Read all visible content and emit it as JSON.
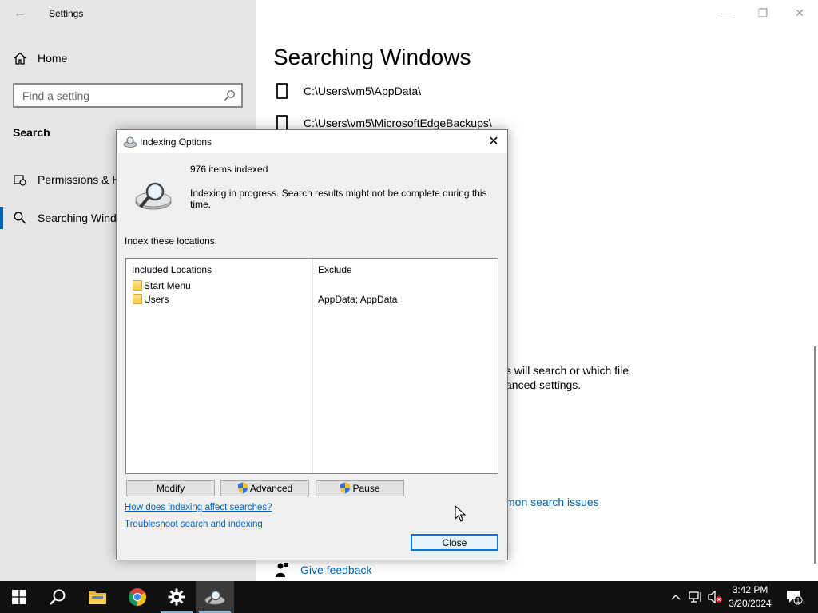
{
  "settings": {
    "app_title": "Settings",
    "nav": {
      "home_label": "Home",
      "search_placeholder": "Find a setting",
      "section_title": "Search",
      "items": [
        {
          "label": "Permissions & History"
        },
        {
          "label": "Searching Windows"
        }
      ]
    },
    "main": {
      "page_title": "Searching Windows",
      "excluded_folders": [
        {
          "path": "C:\\Users\\vm5\\AppData\\"
        },
        {
          "path": "C:\\Users\\vm5\\MicrosoftEdgeBackups\\"
        }
      ],
      "partial_text_line1": "s will search or which file",
      "partial_text_line2": "anced settings.",
      "partial_link": "mon search issues",
      "feedback_label": "Give feedback"
    }
  },
  "dialog": {
    "title": "Indexing Options",
    "items_indexed": "976 items indexed",
    "status_message": "Indexing in progress. Search results might not be complete during this time.",
    "index_label": "Index these locations:",
    "columns": {
      "included": "Included Locations",
      "exclude": "Exclude"
    },
    "locations": [
      {
        "name": "Start Menu",
        "exclude": ""
      },
      {
        "name": "Users",
        "exclude": "AppData; AppData"
      }
    ],
    "buttons": {
      "modify": "Modify",
      "advanced": "Advanced",
      "pause": "Pause",
      "close": "Close"
    },
    "links": {
      "how": "How does indexing affect searches?",
      "troubleshoot": "Troubleshoot search and indexing"
    }
  },
  "taskbar": {
    "time": "3:42 PM",
    "date": "3/20/2024",
    "notification_count": "1"
  },
  "colors": {
    "accent": "#0063b1",
    "link": "#0066cc",
    "taskbar": "#101010"
  }
}
